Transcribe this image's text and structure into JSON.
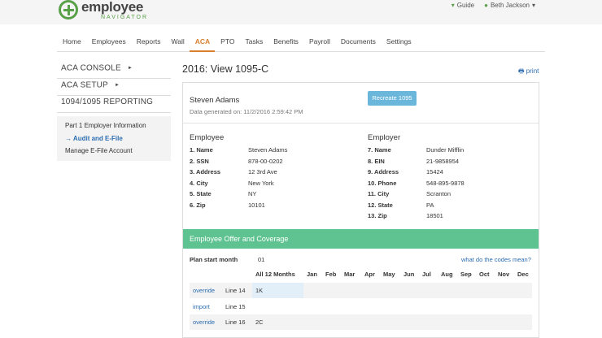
{
  "app": {
    "logo_main": "employee",
    "logo_sub": "NAVIGATOR"
  },
  "topbar": {
    "guide_label": "Guide",
    "user_label": "Beth Jackson",
    "user_caret": "▾"
  },
  "nav": [
    "Home",
    "Employees",
    "Reports",
    "Wall",
    "ACA",
    "PTO",
    "Tasks",
    "Benefits",
    "Payroll",
    "Documents",
    "Settings"
  ],
  "nav_active": "ACA",
  "sidebar": {
    "sections": [
      {
        "label": "ACA CONSOLE",
        "caret": "►"
      },
      {
        "label": "ACA SETUP",
        "caret": "►"
      },
      {
        "label": "1094/1095 REPORTING",
        "caret": ""
      }
    ],
    "sub_items": [
      "Part 1 Employer Information",
      "→ Audit and E-File",
      "Manage E-File Account"
    ]
  },
  "page": {
    "title": "2016: View 1095-C",
    "print_label": "print"
  },
  "header": {
    "person": "Steven Adams",
    "generated": "Data generated on: 11/2/2016 2:59:42 PM",
    "recreate_label": "Recreate 1095"
  },
  "employee": {
    "title": "Employee",
    "fields": [
      {
        "k": "1. Name",
        "v": "Steven Adams"
      },
      {
        "k": "2. SSN",
        "v": "878-00-0202"
      },
      {
        "k": "3. Address",
        "v": "12 3rd Ave"
      },
      {
        "k": "4. City",
        "v": "New York"
      },
      {
        "k": "5. State",
        "v": "NY"
      },
      {
        "k": "6. Zip",
        "v": "10101"
      }
    ]
  },
  "employer": {
    "title": "Employer",
    "fields": [
      {
        "k": "7. Name",
        "v": "Dunder Mifflin"
      },
      {
        "k": "8. EIN",
        "v": "21-9858954"
      },
      {
        "k": "9. Address",
        "v": "15424"
      },
      {
        "k": "10. Phone",
        "v": "548-895-9878"
      },
      {
        "k": "11. City",
        "v": "Scranton"
      },
      {
        "k": "12. State",
        "v": "PA"
      },
      {
        "k": "13. Zip",
        "v": "18501"
      }
    ]
  },
  "coverage": {
    "title": "Employee Offer and Coverage",
    "plan_start_label": "Plan start month",
    "plan_start_value": "01",
    "codes_link": "what do the codes mean?",
    "months": [
      "All 12 Months",
      "Jan",
      "Feb",
      "Mar",
      "Apr",
      "May",
      "Jun",
      "Jul",
      "Aug",
      "Sep",
      "Oct",
      "Nov",
      "Dec"
    ],
    "rows": [
      {
        "action": "override",
        "line": "Line 14",
        "all": "1K"
      },
      {
        "action": "import",
        "line": "Line 15",
        "all": ""
      },
      {
        "action": "override",
        "line": "Line 16",
        "all": "2C"
      }
    ]
  }
}
